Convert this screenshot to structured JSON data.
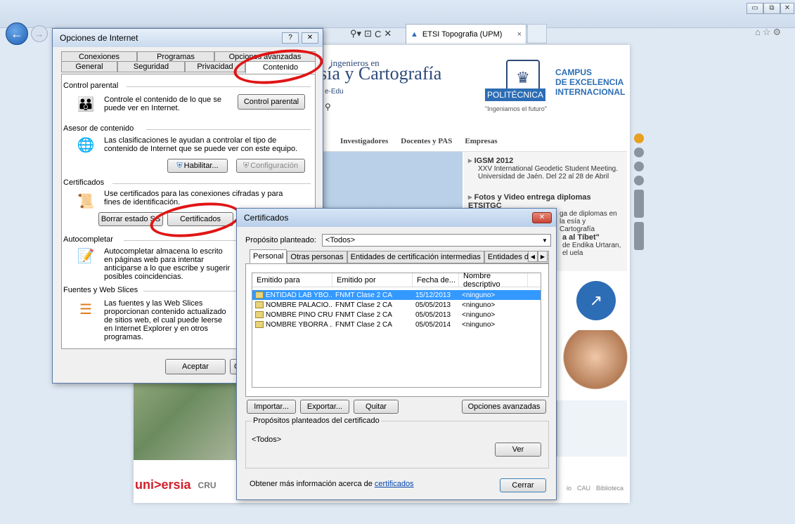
{
  "browser": {
    "tab_title": "ETSI Topografia (UPM)",
    "tab_close": "×",
    "addr_tools": [
      "⚲▾",
      "⊡",
      "C",
      "✕"
    ],
    "window_controls": [
      "▭",
      "⧉",
      "✕"
    ],
    "fav_icons": "⌂☆⚙"
  },
  "page": {
    "subtitle": "ingenieros en",
    "title": "sía y Cartografía",
    "edu": "e-Edu",
    "politecnica": "POLITÉCNICA",
    "ingeniamos": "\"Ingeniamos el futuro\"",
    "campus": [
      "CAMPUS",
      "DE EXCELENCIA",
      "INTERNACIONAL"
    ],
    "nav": [
      "Investigadores",
      "Docentes y PAS",
      "Empresas"
    ],
    "news": [
      {
        "head": "IGSM 2012",
        "body": "XXV International Geodetic Student Meeting. Universidad de Jaén. Del 22 al 28 de Abril"
      },
      {
        "head": "Fotos y Video entrega diplomas ETSITGC",
        "body": "ga de diplomas en la esía y Cartografía"
      },
      {
        "head": "a al Tíbet\"",
        "body": "de Endika Urtaran, el uela"
      }
    ],
    "footer_logo": "uni>ersia",
    "footer_cru": "CRU",
    "footer_links": [
      "io",
      "CAU",
      "Biblioteca"
    ]
  },
  "opciones": {
    "title": "Opciones de Internet",
    "help_btn": "?",
    "close_btn": "✕",
    "tabs_row1": [
      "Conexiones",
      "Programas",
      "Opciones avanzadas"
    ],
    "tabs_row2": [
      "General",
      "Seguridad",
      "Privacidad",
      "Contenido"
    ],
    "control_parental": {
      "group": "Control parental",
      "text": "Controle el contenido de lo que se puede ver en Internet.",
      "button": "Control parental"
    },
    "asesor": {
      "group": "Asesor de contenido",
      "text": "Las clasificaciones le ayudan a controlar el tipo de contenido de Internet que se puede ver con este equipo.",
      "habilitar": "Habilitar...",
      "configuracion": "Configuración"
    },
    "certificados": {
      "group": "Certificados",
      "text": "Use certificados para las conexiones cifradas y para fines de identificación.",
      "borrar": "Borrar estado SS",
      "certificados": "Certificados"
    },
    "autocompletar": {
      "group": "Autocompletar",
      "text": "Autocompletar almacena lo escrito en páginas web para intentar anticiparse a lo que escribe y sugerir posibles coincidencias."
    },
    "fuentes": {
      "group": "Fuentes y Web Slices",
      "text": "Las fuentes y las Web Slices proporcionan contenido actualizado de sitios web, el cual puede leerse en Internet Explorer y en otros programas."
    },
    "aceptar": "Aceptar",
    "cancelar": "C"
  },
  "cert": {
    "title": "Certificados",
    "close": "✕",
    "proposito_label": "Propósito planteado:",
    "proposito_value": "<Todos>",
    "tabs": [
      "Personal",
      "Otras personas",
      "Entidades de certificación intermedias",
      "Entidades de certificaci"
    ],
    "columns": [
      "Emitido para",
      "Emitido por",
      "Fecha de...",
      "Nombre descriptivo"
    ],
    "rows": [
      [
        "ENTIDAD LAB YBO...",
        "FNMT Clase 2 CA",
        "15/12/2013",
        "<ninguno>"
      ],
      [
        "NOMBRE PALACIO...",
        "FNMT Clase 2 CA",
        "05/05/2013",
        "<ninguno>"
      ],
      [
        "NOMBRE PINO CRU...",
        "FNMT Clase 2 CA",
        "05/05/2013",
        "<ninguno>"
      ],
      [
        "NOMBRE YBORRA ...",
        "FNMT Clase 2 CA",
        "05/05/2014",
        "<ninguno>"
      ]
    ],
    "importar": "Importar...",
    "exportar": "Exportar...",
    "quitar": "Quitar",
    "opciones_avanzadas": "Opciones avanzadas",
    "propositos_group": "Propósitos planteados del certificado",
    "propositos_value": "<Todos>",
    "ver": "Ver",
    "info_text": "Obtener más información acerca de ",
    "info_link": "certificados",
    "cerrar": "Cerrar"
  }
}
